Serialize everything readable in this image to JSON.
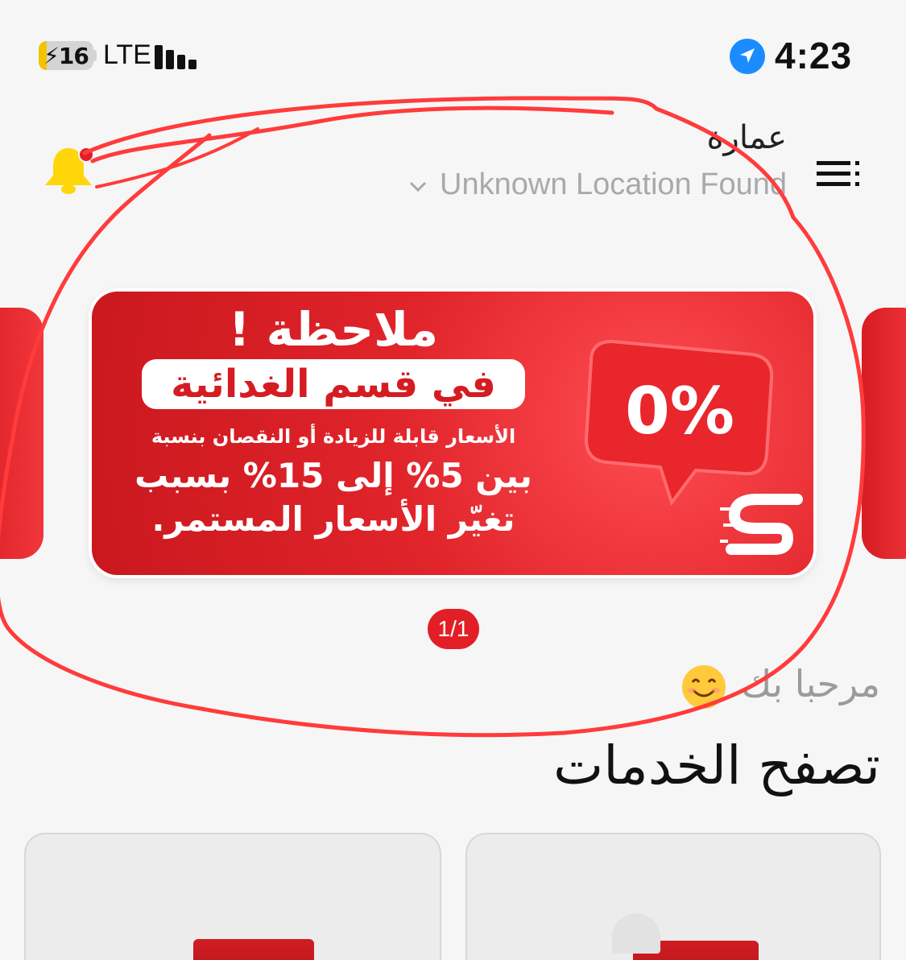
{
  "status_bar": {
    "battery": "16",
    "battery_level_percent": 16,
    "network": "LTE",
    "time": "4:23",
    "icons": [
      "charging-battery-icon",
      "cellular-signal-icon",
      "location-arrow-icon"
    ]
  },
  "header": {
    "location_title": "عمارة",
    "location_subtitle": "Unknown Location Found",
    "icons": [
      "bell-icon",
      "chevron-down-icon",
      "menu-icon"
    ]
  },
  "banner": {
    "headline": "ملاحظة !",
    "pill": "في قسم الغدائية",
    "line1": "الأسعار قابلة للزيادة أو النقصان بنسبة",
    "line2": "بين 5% إلى 15% بسبب",
    "line3": "تغيّر الأسعار المستمر.",
    "badge": "0%",
    "colors": {
      "primary": "#e0242a",
      "dark": "#c9181e"
    }
  },
  "pager": {
    "label": "1/1"
  },
  "welcome": {
    "text": "مرحبا بك",
    "emoji_icon": "smiley-icon"
  },
  "services": {
    "title": "تصفح الخدمات"
  },
  "annotation": {
    "color": "#ff3b3b",
    "shape": "hand-drawn circle"
  }
}
